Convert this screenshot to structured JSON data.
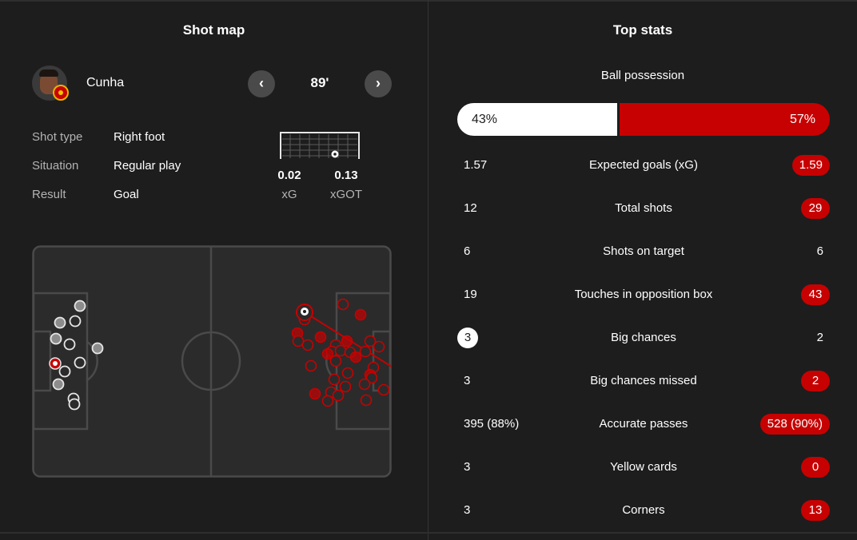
{
  "colors": {
    "away": "#c70101",
    "home": "#ffffff",
    "background": "#1d1d1d"
  },
  "shot_map": {
    "title": "Shot map",
    "player_name": "Cunha",
    "minute": "89'",
    "prev_icon": "chevron-left-icon",
    "next_icon": "chevron-right-icon",
    "details": [
      {
        "label": "Shot type",
        "value": "Right foot"
      },
      {
        "label": "Situation",
        "value": "Regular play"
      },
      {
        "label": "Result",
        "value": "Goal"
      }
    ],
    "xg": {
      "value": "0.02",
      "label": "xG"
    },
    "xgot": {
      "value": "0.13",
      "label": "xGOT"
    }
  },
  "top_stats": {
    "title": "Top stats",
    "possession": {
      "label": "Ball possession",
      "home": "43%",
      "away": "57%",
      "home_fraction": 0.43
    },
    "rows": [
      {
        "label": "Expected goals (xG)",
        "home": "1.57",
        "away": "1.59",
        "home_style": "plain",
        "away_style": "pill"
      },
      {
        "label": "Total shots",
        "home": "12",
        "away": "29",
        "home_style": "plain",
        "away_style": "pill"
      },
      {
        "label": "Shots on target",
        "home": "6",
        "away": "6",
        "home_style": "plain",
        "away_style": "plain"
      },
      {
        "label": "Touches in opposition box",
        "home": "19",
        "away": "43",
        "home_style": "plain",
        "away_style": "pill"
      },
      {
        "label": "Big chances",
        "home": "3",
        "away": "2",
        "home_style": "circle",
        "away_style": "plain"
      },
      {
        "label": "Big chances missed",
        "home": "3",
        "away": "2",
        "home_style": "plain",
        "away_style": "pill"
      },
      {
        "label": "Accurate passes",
        "home": "395 (88%)",
        "away": "528 (90%)",
        "home_style": "plain",
        "away_style": "pill"
      },
      {
        "label": "Yellow cards",
        "home": "3",
        "away": "0",
        "home_style": "plain",
        "away_style": "pill"
      },
      {
        "label": "Corners",
        "home": "3",
        "away": "13",
        "home_style": "plain",
        "away_style": "pill"
      }
    ]
  }
}
